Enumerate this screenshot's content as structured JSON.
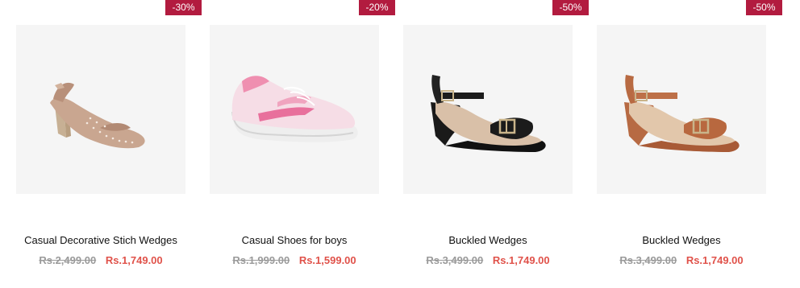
{
  "products": [
    {
      "name": "Casual Decorative Stich Wedges",
      "discount": "-30%",
      "old_price": "Rs.2,499.00",
      "new_price": "Rs.1,749.00",
      "image_icon": "beige-slingback-wedge"
    },
    {
      "name": "Casual Shoes for boys",
      "discount": "-20%",
      "old_price": "Rs.1,999.00",
      "new_price": "Rs.1,599.00",
      "image_icon": "pink-knit-sneaker"
    },
    {
      "name": "Buckled Wedges",
      "discount": "-50%",
      "old_price": "Rs.3,499.00",
      "new_price": "Rs.1,749.00",
      "image_icon": "black-buckled-wedge"
    },
    {
      "name": "Buckled Wedges",
      "discount": "-50%",
      "old_price": "Rs.3,499.00",
      "new_price": "Rs.1,749.00",
      "image_icon": "tan-buckled-wedge"
    }
  ],
  "colors": {
    "badge": "#b21b3f",
    "sale_price": "#e0524a",
    "old_price": "#9a9a9a",
    "image_bg": "#f5f5f5"
  }
}
